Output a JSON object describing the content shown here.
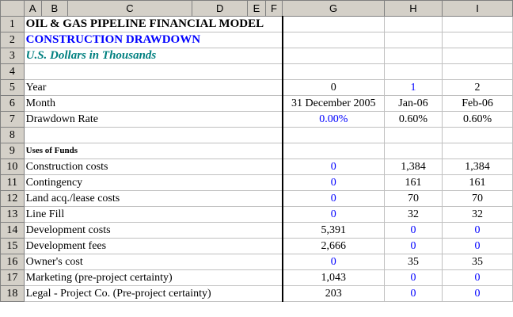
{
  "columns": [
    "A",
    "B",
    "C",
    "D",
    "E",
    "F",
    "G",
    "H",
    "I"
  ],
  "title1": "OIL & GAS PIPELINE FINANCIAL MODEL",
  "title2": "CONSTRUCTION DRAWDOWN",
  "title3": "U.S. Dollars in Thousands",
  "rows": [
    {
      "num": "1"
    },
    {
      "num": "2"
    },
    {
      "num": "3"
    },
    {
      "num": "4"
    },
    {
      "num": "5",
      "label": "Year",
      "g": "0",
      "h": "1",
      "i": "2"
    },
    {
      "num": "6",
      "label": "Month",
      "g": "31 December 2005",
      "h": "Jan-06",
      "i": "Feb-06"
    },
    {
      "num": "7",
      "label": "Drawdown Rate",
      "g": "0.00%",
      "h": "0.60%",
      "i": "0.60%"
    },
    {
      "num": "8"
    },
    {
      "num": "9",
      "label": "Uses of Funds"
    },
    {
      "num": "10",
      "label": "Construction costs",
      "g": "0",
      "h": "1,384",
      "i": "1,384"
    },
    {
      "num": "11",
      "label": "Contingency",
      "g": "0",
      "h": "161",
      "i": "161"
    },
    {
      "num": "12",
      "label": "Land acq./lease costs",
      "g": "0",
      "h": "70",
      "i": "70"
    },
    {
      "num": "13",
      "label": "Line Fill",
      "g": "0",
      "h": "32",
      "i": "32"
    },
    {
      "num": "14",
      "label": "Development costs",
      "g": "5,391",
      "h": "0",
      "i": "0"
    },
    {
      "num": "15",
      "label": "Development fees",
      "g": "2,666",
      "h": "0",
      "i": "0"
    },
    {
      "num": "16",
      "label": "Owner's cost",
      "g": "0",
      "h": "35",
      "i": "35"
    },
    {
      "num": "17",
      "label": "Marketing (pre-project certainty)",
      "g": "1,043",
      "h": "0",
      "i": "0"
    },
    {
      "num": "18",
      "label": "Legal - Project Co. (Pre-project certainty)",
      "g": "203",
      "h": "0",
      "i": "0"
    }
  ],
  "colors": {
    "input_blue": "#0000ff",
    "teal": "#008080",
    "header_gray": "#d4d0c8"
  }
}
